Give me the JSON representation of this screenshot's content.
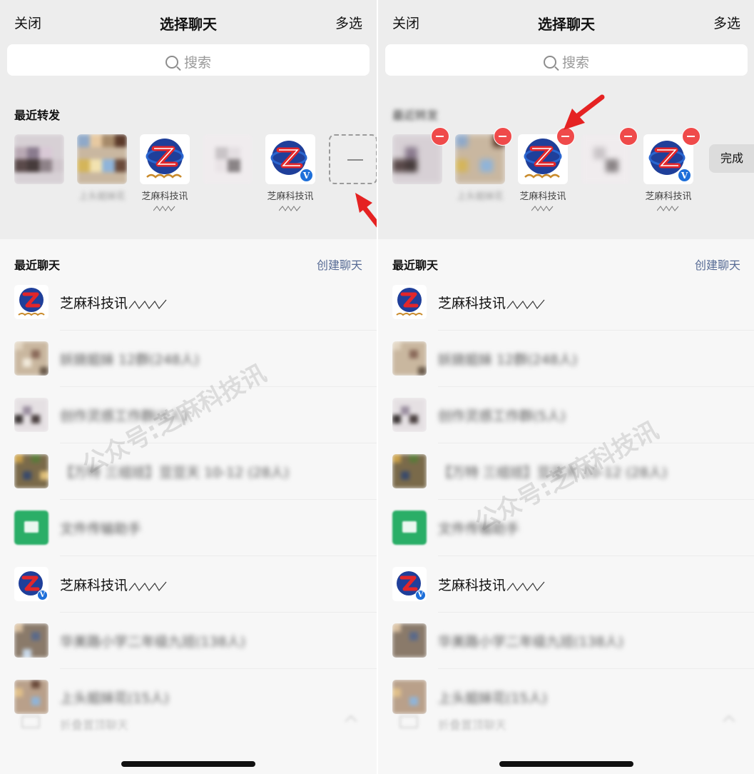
{
  "left_screen": {
    "nav": {
      "close": "关闭",
      "title": "选择聊天",
      "multi_select": "多选"
    },
    "search": {
      "placeholder": "搜索"
    },
    "recent_forward_title": "最近转发",
    "forward_items": [
      {
        "name": ""
      },
      {
        "name": "上头姐妹花"
      },
      {
        "name": "芝麻科技讯"
      },
      {
        "name": ""
      },
      {
        "name": "芝麻科技讯"
      }
    ],
    "recent_chats_title": "最近聊天",
    "create_chat": "创建聊天",
    "chats": [
      {
        "name": "芝麻科技讯"
      },
      {
        "name": "妖娆姐妹 12群(248人)"
      },
      {
        "name": "创作灵感工作群(5人)"
      },
      {
        "name": "【万特 三组班】豆豆天 10-12 (28人)"
      },
      {
        "name": "文件传输助手"
      },
      {
        "name": "芝麻科技讯"
      },
      {
        "name": "华美路小学二年级九班(138人)"
      },
      {
        "name": "上头姐妹花(15人)"
      }
    ],
    "folded_chats": "折叠置顶聊天"
  },
  "right_screen": {
    "nav": {
      "close": "关闭",
      "title": "选择聊天",
      "multi_select": "多选"
    },
    "search": {
      "placeholder": "搜索"
    },
    "recent_forward_title": "最近转发",
    "forward_items": [
      {
        "name": ""
      },
      {
        "name": "上头姐妹花"
      },
      {
        "name": "芝麻科技讯"
      },
      {
        "name": ""
      },
      {
        "name": "芝麻科技讯"
      }
    ],
    "done_button": "完成",
    "recent_chats_title": "最近聊天",
    "create_chat": "创建聊天",
    "chats": [
      {
        "name": "芝麻科技讯"
      },
      {
        "name": "妖娆姐妹 12群(248人)"
      },
      {
        "name": "创作灵感工作群(5人)"
      },
      {
        "name": "【万特 三组班】豆豆天 10-12 (28人)"
      },
      {
        "name": "文件传输助手"
      },
      {
        "name": "芝麻科技讯"
      },
      {
        "name": "华美路小学二年级九班(138人)"
      },
      {
        "name": "上头姐妹花(15人)"
      }
    ],
    "folded_chats": "折叠置顶聊天"
  },
  "watermark": "公众号:芝麻科技讯",
  "colors": {
    "link_blue": "#576b95",
    "remove_red": "#ef4a4a",
    "annotation_arrow": "#e52222",
    "file_helper_green": "#2aae67",
    "verified_badge": "#1e6fd9"
  }
}
